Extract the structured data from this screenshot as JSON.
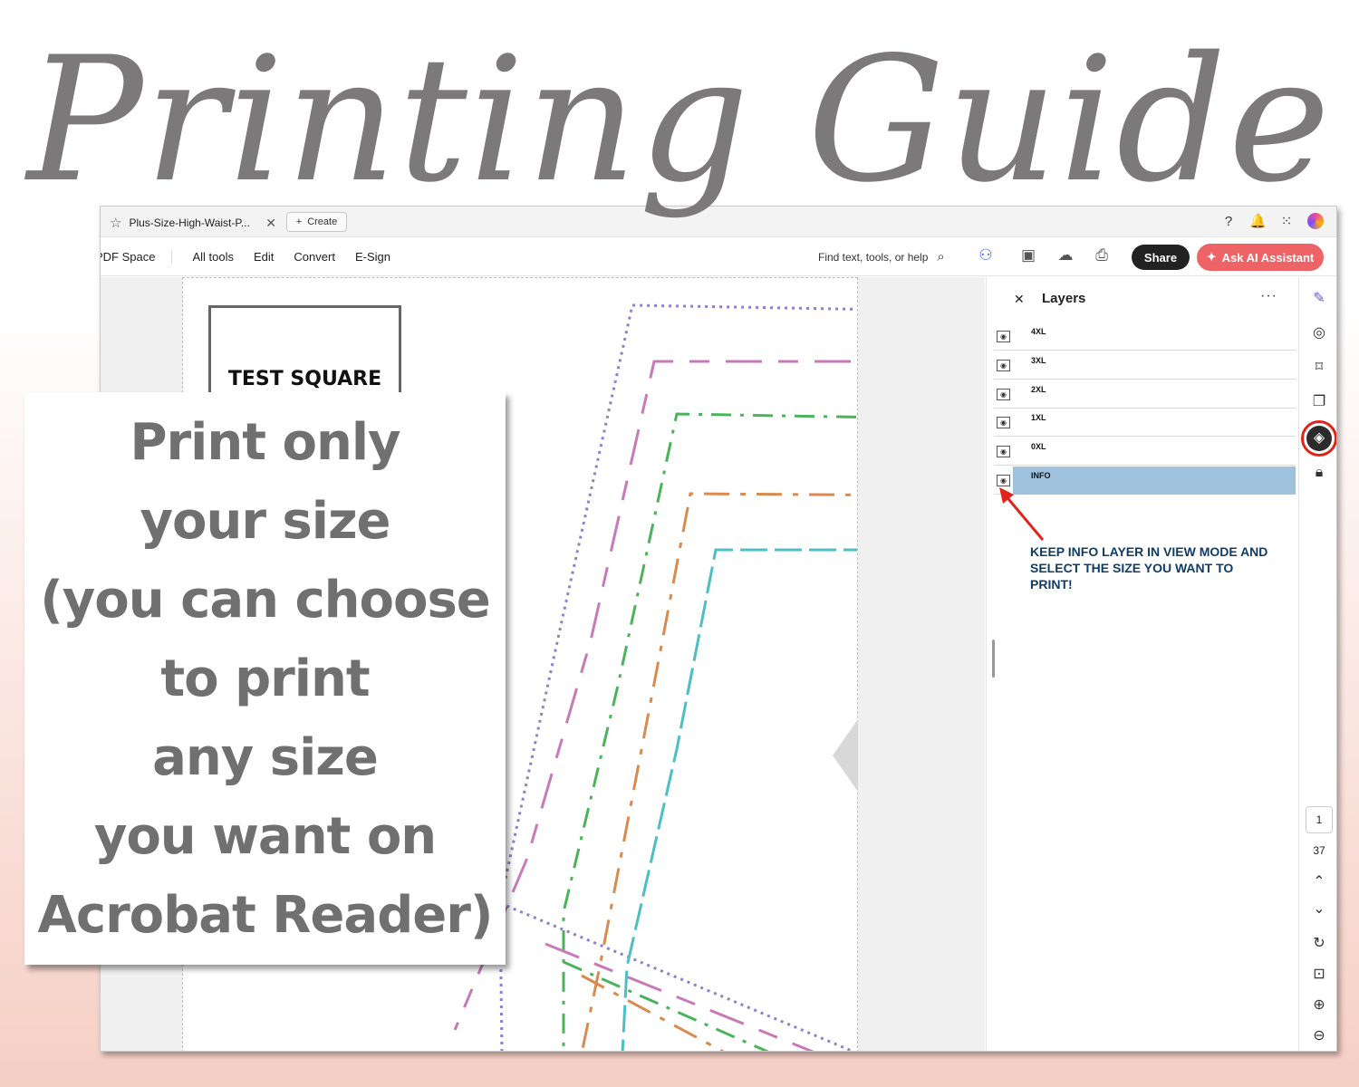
{
  "title": "Printing Guide",
  "browser_tab": {
    "label": "Plus-Size-High-Waist-P...",
    "close_symbol": "✕",
    "create_label": "Create"
  },
  "toolbar": {
    "pdf_space": "PDF Space",
    "menu": [
      "All tools",
      "Edit",
      "Convert",
      "E-Sign"
    ],
    "search_placeholder": "Find text, tools, or help",
    "share_label": "Share",
    "ai_label": "Ask AI Assistant"
  },
  "document": {
    "test_square_label": "TEST SQUARE"
  },
  "layers": {
    "title": "Layers",
    "items": [
      {
        "name": "4XL",
        "selected": false
      },
      {
        "name": "3XL",
        "selected": false
      },
      {
        "name": "2XL",
        "selected": false
      },
      {
        "name": "1XL",
        "selected": false
      },
      {
        "name": "0XL",
        "selected": false
      },
      {
        "name": "INFO",
        "selected": true
      }
    ],
    "callout": "KEEP INFO LAYER IN VIEW MODE AND SELECT THE SIZE YOU WANT TO PRINT!"
  },
  "navigation": {
    "current_page": "1",
    "total_pages": "37"
  },
  "info_card": {
    "lines": [
      "Print only",
      "your size",
      "(you can choose",
      "to print",
      "any size",
      "you want on",
      "Acrobat Reader)"
    ]
  },
  "colors": {
    "title": "#7b7979",
    "share_button": "#222222",
    "ai_button": "#ee6466",
    "selected_layer": "#9ec2dd",
    "highlight_ring": "#e0241b",
    "callout_text": "#0f3d66",
    "pattern_purple": "#8a84c6",
    "pattern_pink": "#c77ab8",
    "pattern_green": "#4bb35a",
    "pattern_orange": "#d98a4c",
    "pattern_teal": "#4cbfc2"
  }
}
